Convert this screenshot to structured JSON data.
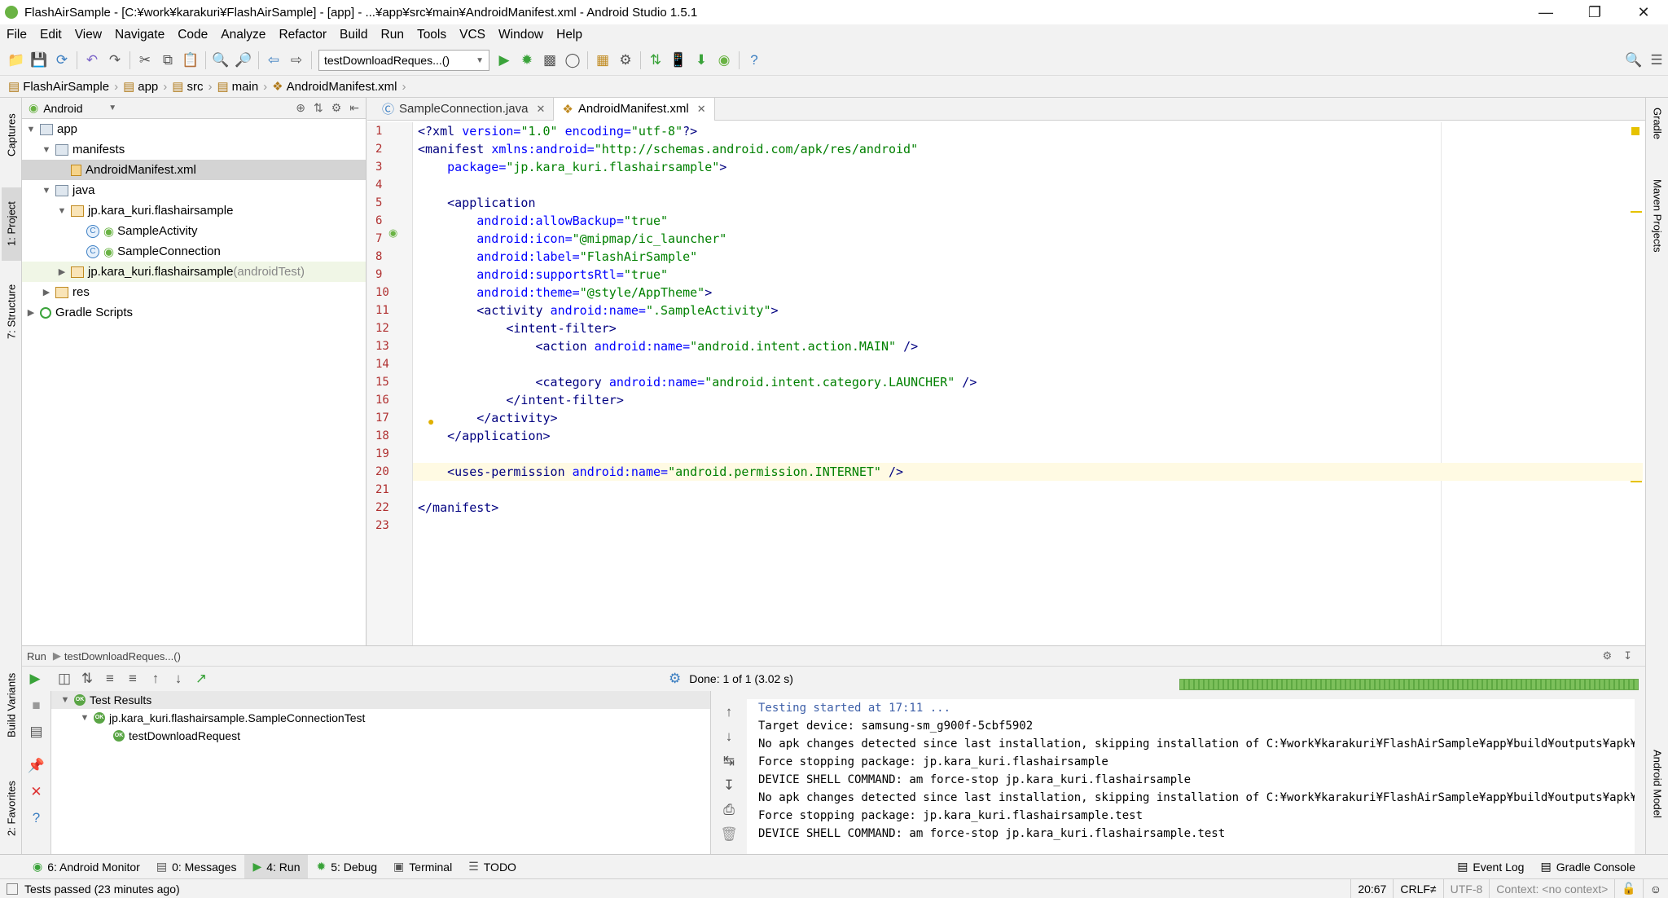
{
  "window": {
    "title": "FlashAirSample - [C:¥work¥karakuri¥FlashAirSample] - [app] - ...¥app¥src¥main¥AndroidManifest.xml - Android Studio 1.5.1",
    "controls": [
      "—",
      "❐",
      "✕"
    ]
  },
  "menu": [
    "File",
    "Edit",
    "View",
    "Navigate",
    "Code",
    "Analyze",
    "Refactor",
    "Build",
    "Run",
    "Tools",
    "VCS",
    "Window",
    "Help"
  ],
  "toolbar": {
    "run_config": "testDownloadReques...()"
  },
  "breadcrumb": [
    "FlashAirSample",
    "app",
    "src",
    "main",
    "AndroidManifest.xml"
  ],
  "left_tool_tabs": [
    "Captures",
    "1: Project",
    "7: Structure",
    "Build Variants",
    "2: Favorites"
  ],
  "right_tool_tabs": [
    "Gradle",
    "Maven Projects",
    "Android Model"
  ],
  "project": {
    "view_mode": "Android",
    "tree": [
      {
        "label": "app",
        "level": 0,
        "icon": "folder",
        "expanded": true
      },
      {
        "label": "manifests",
        "level": 1,
        "icon": "folder",
        "expanded": true
      },
      {
        "label": "AndroidManifest.xml",
        "level": 2,
        "icon": "xml",
        "selected": true
      },
      {
        "label": "java",
        "level": 1,
        "icon": "folder",
        "expanded": true
      },
      {
        "label": "jp.kara_kuri.flashairsample",
        "level": 2,
        "icon": "package",
        "expanded": true
      },
      {
        "label": "SampleActivity",
        "level": 3,
        "icon": "class"
      },
      {
        "label": "SampleConnection",
        "level": 3,
        "icon": "class"
      },
      {
        "label": "jp.kara_kuri.flashairsample",
        "suffix": " (androidTest)",
        "level": 2,
        "icon": "package",
        "collapsed": true,
        "highlight": true
      },
      {
        "label": "res",
        "level": 1,
        "icon": "folder",
        "collapsed": true
      },
      {
        "label": "Gradle Scripts",
        "level": 0,
        "icon": "gradle",
        "collapsed": true
      }
    ]
  },
  "editor": {
    "tabs": [
      {
        "label": "SampleConnection.java",
        "active": false
      },
      {
        "label": "AndroidManifest.xml",
        "active": true
      }
    ],
    "lines": [
      [
        [
          "<?xml ",
          "tg"
        ],
        [
          "version=",
          "an"
        ],
        [
          "\"1.0\" ",
          "av"
        ],
        [
          "encoding=",
          "an"
        ],
        [
          "\"utf-8\"",
          "av"
        ],
        [
          "?>",
          "tg"
        ]
      ],
      [
        [
          "<manifest ",
          "tg"
        ],
        [
          "xmlns:android=",
          "an"
        ],
        [
          "\"http://schemas.android.com/apk/res/android\"",
          "av"
        ]
      ],
      [
        [
          "    package=",
          "an"
        ],
        [
          "\"jp.kara_kuri.flashairsample\"",
          "av"
        ],
        [
          ">",
          "tg"
        ]
      ],
      [],
      [
        [
          "    <application",
          "tg"
        ]
      ],
      [
        [
          "        android:allowBackup=",
          "an"
        ],
        [
          "\"true\"",
          "av"
        ]
      ],
      [
        [
          "        android:icon=",
          "an"
        ],
        [
          "\"@mipmap/ic_launcher\"",
          "av"
        ]
      ],
      [
        [
          "        android:label=",
          "an"
        ],
        [
          "\"FlashAirSample\"",
          "av"
        ]
      ],
      [
        [
          "        android:supportsRtl=",
          "an"
        ],
        [
          "\"true\"",
          "av"
        ]
      ],
      [
        [
          "        android:theme=",
          "an"
        ],
        [
          "\"@style/AppTheme\"",
          "av"
        ],
        [
          ">",
          "tg"
        ]
      ],
      [
        [
          "        <activity ",
          "tg"
        ],
        [
          "android:name=",
          "an"
        ],
        [
          "\".SampleActivity\"",
          "av"
        ],
        [
          ">",
          "tg"
        ]
      ],
      [
        [
          "            <intent-filter>",
          "tg"
        ]
      ],
      [
        [
          "                <action ",
          "tg"
        ],
        [
          "android:name=",
          "an"
        ],
        [
          "\"android.intent.action.MAIN\" ",
          "av"
        ],
        [
          "/>",
          "tg"
        ]
      ],
      [],
      [
        [
          "                <category ",
          "tg"
        ],
        [
          "android:name=",
          "an"
        ],
        [
          "\"android.intent.category.LAUNCHER\" ",
          "av"
        ],
        [
          "/>",
          "tg"
        ]
      ],
      [
        [
          "            </intent-filter>",
          "tg"
        ]
      ],
      [
        [
          "        </activity>",
          "tg"
        ]
      ],
      [
        [
          "    </application>",
          "tg"
        ]
      ],
      [],
      [
        [
          "    <uses-permission ",
          "tg"
        ],
        [
          "android:name=",
          "an"
        ],
        [
          "\"android.permission.INTERNET\" ",
          "av"
        ],
        [
          "/>",
          "tg"
        ]
      ],
      [],
      [
        [
          "</manifest>",
          "tg"
        ]
      ],
      []
    ],
    "current_line": 20
  },
  "run_panel": {
    "header": "Run",
    "config": "testDownloadReques...()",
    "status": "Done: 1 of 1  (3.02 s)",
    "progress": 1.0,
    "tests": [
      {
        "label": "Test Results",
        "level": 0
      },
      {
        "label": "jp.kara_kuri.flashairsample.SampleConnectionTest",
        "level": 1
      },
      {
        "label": "testDownloadRequest",
        "level": 2
      }
    ],
    "console": [
      "Testing started at 17:11 ...",
      "Target device: samsung-sm_g900f-5cbf5902",
      "No apk changes detected since last installation, skipping installation of C:¥work¥karakuri¥FlashAirSample¥app¥build¥outputs¥apk¥app-del",
      "Force stopping package: jp.kara_kuri.flashairsample",
      "DEVICE SHELL COMMAND: am force-stop jp.kara_kuri.flashairsample",
      "No apk changes detected since last installation, skipping installation of C:¥work¥karakuri¥FlashAirSample¥app¥build¥outputs¥apk¥app-del",
      "Force stopping package: jp.kara_kuri.flashairsample.test",
      "DEVICE SHELL COMMAND: am force-stop jp.kara_kuri.flashairsample.test"
    ]
  },
  "bottom_tabs": [
    {
      "label": "6: Android Monitor",
      "active": false
    },
    {
      "label": "0: Messages",
      "active": false
    },
    {
      "label": "4: Run",
      "active": true
    },
    {
      "label": "5: Debug",
      "active": false
    },
    {
      "label": "Terminal",
      "active": false
    },
    {
      "label": "TODO",
      "active": false
    }
  ],
  "bottom_right_tabs": [
    "Event Log",
    "Gradle Console"
  ],
  "status": {
    "message": "Tests passed (23 minutes ago)",
    "position": "20:67",
    "line_sep": "CRLF≠",
    "encoding": "UTF-8",
    "context": "Context: <no context>"
  },
  "colors": {
    "tag": "#000080",
    "attr": "#0000ff",
    "value": "#008000",
    "linenum": "#b03030"
  }
}
